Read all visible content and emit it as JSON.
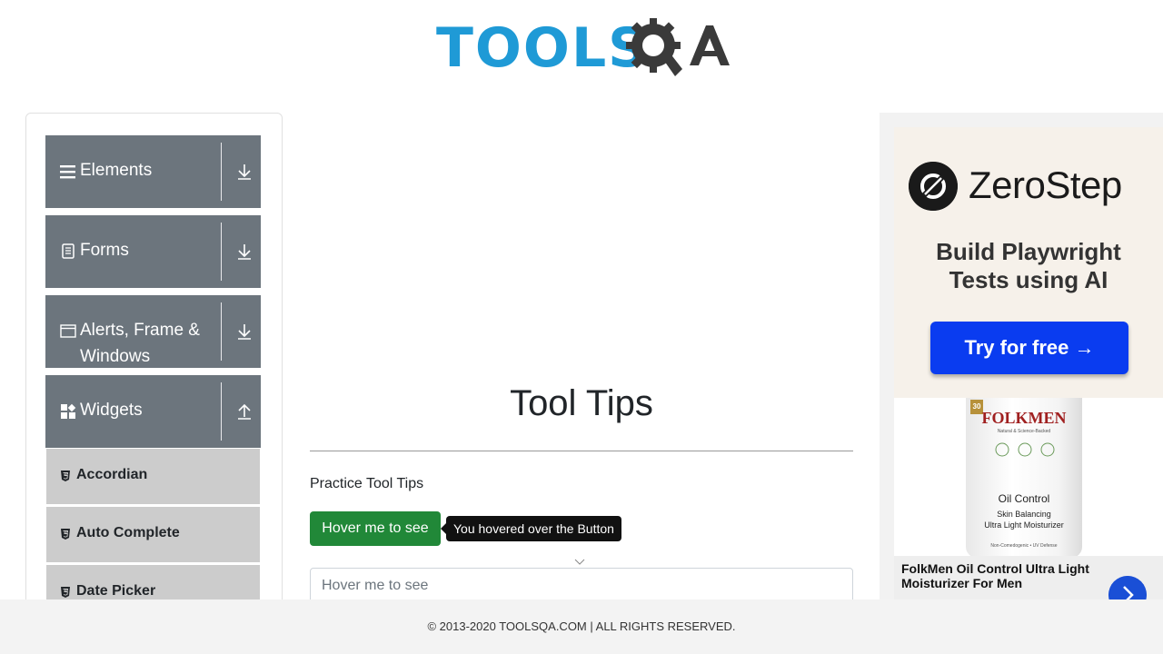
{
  "brand": {
    "logo_text": "TOOLS",
    "logo_qa": "QA"
  },
  "sidebar": {
    "groups": [
      {
        "label": "Elements",
        "icon": "hamburger-icon",
        "arrow": "download-arrow-icon"
      },
      {
        "label": "Forms",
        "icon": "document-icon",
        "arrow": "download-arrow-icon"
      },
      {
        "label": "Alerts, Frame &",
        "label2": "Windows",
        "icon": "window-icon",
        "arrow": "download-arrow-icon"
      },
      {
        "label": "Widgets",
        "icon": "widgets-icon",
        "arrow": "upload-arrow-icon"
      }
    ],
    "widget_items": [
      {
        "label": "Accordian"
      },
      {
        "label": "Auto Complete"
      },
      {
        "label": "Date Picker"
      }
    ]
  },
  "main": {
    "title": "Tool Tips",
    "practice_label": "Practice Tool Tips",
    "hover_button_label": "Hover me to see",
    "tooltip_text": "You hovered over the Button",
    "input_placeholder": "Hover me to see"
  },
  "ad": {
    "brand": "ZeroStep",
    "tagline_1": "Build Playwright",
    "tagline_2": "Tests using AI",
    "cta": "Try for free →",
    "product_spf": "30",
    "product_brand": "FOLKMEN",
    "product_brand_sub": "Natural & Science-Backed",
    "product_name": "Oil Control",
    "product_sub_1": "Skin Balancing",
    "product_sub_2": "Ultra Light Moisturizer",
    "product_tiny": "Non-Comedogenic • UV Defense",
    "caption": "FolkMen Oil Control Ultra Light Moisturizer For Men"
  },
  "footer": {
    "text": "© 2013-2020 TOOLSQA.COM | ALL RIGHTS RESERVED."
  },
  "colors": {
    "brand_blue": "#1f9ad6",
    "sidebar_group": "#6c757d",
    "sidebar_item": "#cccccc",
    "button_green": "#218838",
    "ad_blue": "#0a3cf0"
  }
}
